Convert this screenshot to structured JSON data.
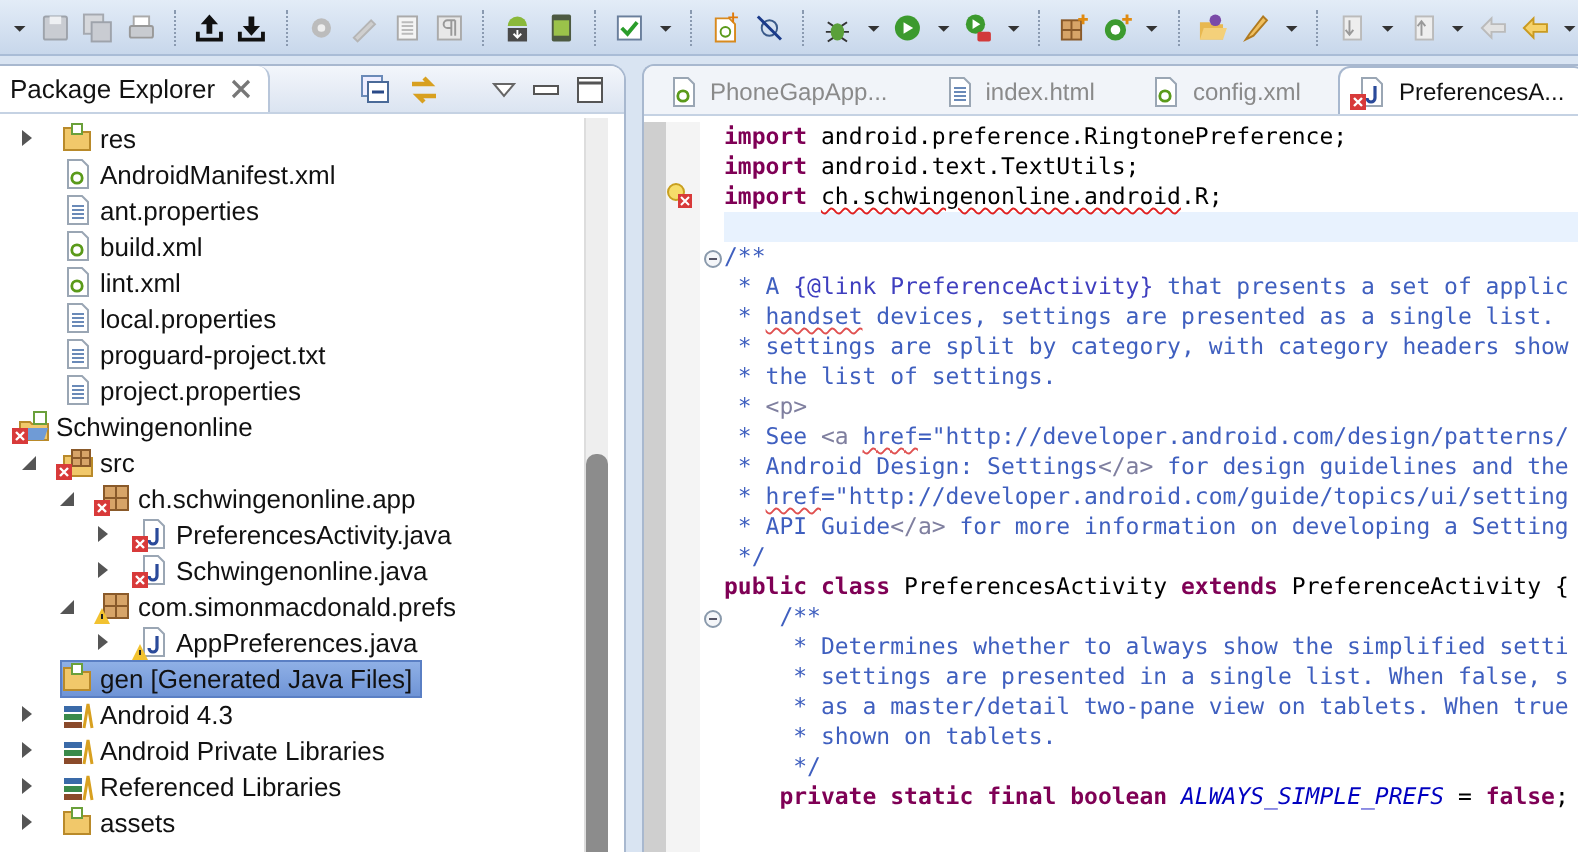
{
  "package_explorer": {
    "title": "Package Explorer",
    "tree": [
      {
        "children": [
          {
            "label": "res",
            "kind": "folder",
            "error": false,
            "warning": false,
            "expanded": false,
            "selected": false
          },
          {
            "label": "AndroidManifest.xml",
            "kind": "android-xml",
            "error": false,
            "warning": false,
            "selected": false
          },
          {
            "label": "ant.properties",
            "kind": "text-file",
            "error": false,
            "warning": false,
            "selected": false
          },
          {
            "label": "build.xml",
            "kind": "android-xml",
            "error": false,
            "warning": false,
            "selected": false
          },
          {
            "label": "lint.xml",
            "kind": "android-xml",
            "error": false,
            "warning": false,
            "selected": false
          },
          {
            "label": "local.properties",
            "kind": "text-file",
            "error": false,
            "warning": false,
            "selected": false
          },
          {
            "label": "proguard-project.txt",
            "kind": "text-file",
            "error": false,
            "warning": false,
            "selected": false
          },
          {
            "label": "project.properties",
            "kind": "text-file",
            "error": false,
            "warning": false,
            "selected": false
          }
        ]
      },
      {
        "label": "Schwingenonline",
        "kind": "project",
        "error": true,
        "warning": false,
        "selected": false,
        "children": [
          {
            "label": "src",
            "kind": "source-folder",
            "error": true,
            "warning": false,
            "expanded": true,
            "selected": false,
            "children": [
              {
                "label": "ch.schwingenonline.app",
                "kind": "package",
                "error": true,
                "warning": false,
                "expanded": true,
                "selected": false,
                "children": [
                  {
                    "label": "PreferencesActivity.java",
                    "kind": "java",
                    "error": true,
                    "warning": false,
                    "expanded": false,
                    "selected": false
                  },
                  {
                    "label": "Schwingenonline.java",
                    "kind": "java",
                    "error": true,
                    "warning": false,
                    "expanded": false,
                    "selected": false
                  }
                ]
              },
              {
                "label": "com.simonmacdonald.prefs",
                "kind": "package",
                "error": false,
                "warning": true,
                "expanded": true,
                "selected": false,
                "children": [
                  {
                    "label": "AppPreferences.java",
                    "kind": "java",
                    "error": false,
                    "warning": true,
                    "expanded": false,
                    "selected": false
                  }
                ]
              }
            ]
          },
          {
            "label": "gen [Generated Java Files]",
            "kind": "folder",
            "error": false,
            "warning": false,
            "selected": true
          },
          {
            "label": "Android 4.3",
            "kind": "library",
            "error": false,
            "warning": false,
            "expanded": false,
            "selected": false
          },
          {
            "label": "Android Private Libraries",
            "kind": "library",
            "error": false,
            "warning": false,
            "expanded": false,
            "selected": false
          },
          {
            "label": "Referenced Libraries",
            "kind": "library",
            "error": false,
            "warning": false,
            "expanded": false,
            "selected": false
          },
          {
            "label": "assets",
            "kind": "folder",
            "error": false,
            "warning": false,
            "expanded": false,
            "selected": false
          }
        ]
      }
    ]
  },
  "editor": {
    "tabs": [
      {
        "label": "PhoneGapApp...",
        "kind": "android-xml",
        "error": false,
        "warning": false,
        "selected": false
      },
      {
        "label": "index.html",
        "kind": "text-file",
        "error": false,
        "warning": false,
        "selected": false
      },
      {
        "label": "config.xml",
        "kind": "android-xml",
        "error": false,
        "warning": false,
        "selected": false
      },
      {
        "label": "PreferencesA...",
        "kind": "java",
        "error": true,
        "warning": false,
        "selected": true
      }
    ],
    "lines": [
      {
        "fold": false,
        "current": false,
        "error_marker": false,
        "segments": [
          {
            "kind": "keyword",
            "text": "import "
          },
          {
            "kind": "plain",
            "text": "android.preference.RingtonePreference;"
          }
        ]
      },
      {
        "fold": false,
        "current": false,
        "error_marker": false,
        "segments": [
          {
            "kind": "keyword",
            "text": "import "
          },
          {
            "kind": "plain",
            "text": "android.text.TextUtils;"
          }
        ]
      },
      {
        "fold": false,
        "current": false,
        "error_marker": true,
        "segments": [
          {
            "kind": "keyword",
            "text": "import "
          },
          {
            "kind": "unresolved",
            "text": "ch.schwingenonline.android"
          },
          {
            "kind": "plain",
            "text": ".R;"
          }
        ]
      },
      {
        "fold": false,
        "current": true,
        "error_marker": false
      },
      {
        "fold": true,
        "current": false,
        "error_marker": false,
        "segments": [
          {
            "kind": "doc",
            "text": "/**"
          }
        ]
      },
      {
        "fold": false,
        "current": false,
        "error_marker": false,
        "segments": [
          {
            "kind": "doc",
            "text": " * A "
          },
          {
            "kind": "doc-link",
            "text": "{@link PreferenceActivity}"
          },
          {
            "kind": "doc",
            "text": " that presents a set of applic"
          }
        ]
      },
      {
        "fold": false,
        "current": false,
        "error_marker": false,
        "segments": [
          {
            "kind": "doc",
            "text": " * "
          },
          {
            "kind": "misspelled",
            "text": "handset"
          },
          {
            "kind": "doc",
            "text": " devices, settings are presented as a single list."
          }
        ]
      },
      {
        "fold": false,
        "current": false,
        "error_marker": false,
        "segments": [
          {
            "kind": "doc",
            "text": " * settings are split by category, with category headers show"
          }
        ]
      },
      {
        "fold": false,
        "current": false,
        "error_marker": false,
        "segments": [
          {
            "kind": "doc",
            "text": " * the list of settings."
          }
        ]
      },
      {
        "fold": false,
        "current": false,
        "error_marker": false,
        "segments": [
          {
            "kind": "doc",
            "text": " * "
          },
          {
            "kind": "doc-tag",
            "text": "<p>"
          }
        ]
      },
      {
        "fold": false,
        "current": false,
        "error_marker": false,
        "segments": [
          {
            "kind": "doc",
            "text": " * See "
          },
          {
            "kind": "doc-tag",
            "text": "<a "
          },
          {
            "kind": "misspelled",
            "text": "href"
          },
          {
            "kind": "doc",
            "text": "=\"http://developer.android.com/design/patterns/"
          }
        ]
      },
      {
        "fold": false,
        "current": false,
        "error_marker": false,
        "segments": [
          {
            "kind": "doc",
            "text": " * Android Design: Settings"
          },
          {
            "kind": "doc-tag",
            "text": "</a>"
          },
          {
            "kind": "doc",
            "text": " for design guidelines and the"
          }
        ]
      },
      {
        "fold": false,
        "current": false,
        "error_marker": false,
        "segments": [
          {
            "kind": "doc",
            "text": " * "
          },
          {
            "kind": "misspelled",
            "text": "href"
          },
          {
            "kind": "doc",
            "text": "=\"http://developer.android.com/guide/topics/ui/setting"
          }
        ]
      },
      {
        "fold": false,
        "current": false,
        "error_marker": false,
        "segments": [
          {
            "kind": "doc",
            "text": " * API Guide"
          },
          {
            "kind": "doc-tag",
            "text": "</a>"
          },
          {
            "kind": "doc",
            "text": " for more information on developing a Setting"
          }
        ]
      },
      {
        "fold": false,
        "current": false,
        "error_marker": false,
        "segments": [
          {
            "kind": "doc",
            "text": " */"
          }
        ]
      },
      {
        "fold": false,
        "current": false,
        "error_marker": false,
        "segments": [
          {
            "kind": "keyword",
            "text": "public "
          },
          {
            "kind": "keyword",
            "text": "class "
          },
          {
            "kind": "plain",
            "text": "PreferencesActivity "
          },
          {
            "kind": "keyword",
            "text": "extends "
          },
          {
            "kind": "plain",
            "text": "PreferenceActivity {"
          }
        ]
      },
      {
        "fold": true,
        "current": false,
        "error_marker": false,
        "segments": [
          {
            "kind": "doc",
            "text": "    /**"
          }
        ]
      },
      {
        "fold": false,
        "current": false,
        "error_marker": false,
        "segments": [
          {
            "kind": "doc",
            "text": "     * Determines whether to always show the simplified setti"
          }
        ]
      },
      {
        "fold": false,
        "current": false,
        "error_marker": false,
        "segments": [
          {
            "kind": "doc",
            "text": "     * settings are presented in a single list. When false, s"
          }
        ]
      },
      {
        "fold": false,
        "current": false,
        "error_marker": false,
        "segments": [
          {
            "kind": "doc",
            "text": "     * as a master/detail two-pane view on tablets. When true"
          }
        ]
      },
      {
        "fold": false,
        "current": false,
        "error_marker": false,
        "segments": [
          {
            "kind": "doc",
            "text": "     * shown on tablets."
          }
        ]
      },
      {
        "fold": false,
        "current": false,
        "error_marker": false,
        "segments": [
          {
            "kind": "doc",
            "text": "     */"
          }
        ]
      },
      {
        "fold": false,
        "current": false,
        "error_marker": false,
        "segments": [
          {
            "kind": "keyword",
            "text": "    private "
          },
          {
            "kind": "keyword",
            "text": "static "
          },
          {
            "kind": "keyword",
            "text": "final "
          },
          {
            "kind": "keyword",
            "text": "boolean "
          },
          {
            "kind": "constant",
            "text": "ALWAYS_SIMPLE_PREFS"
          },
          {
            "kind": "plain",
            "text": " = "
          },
          {
            "kind": "keyword",
            "text": "false"
          },
          {
            "kind": "plain",
            "text": ";"
          }
        ]
      }
    ]
  }
}
